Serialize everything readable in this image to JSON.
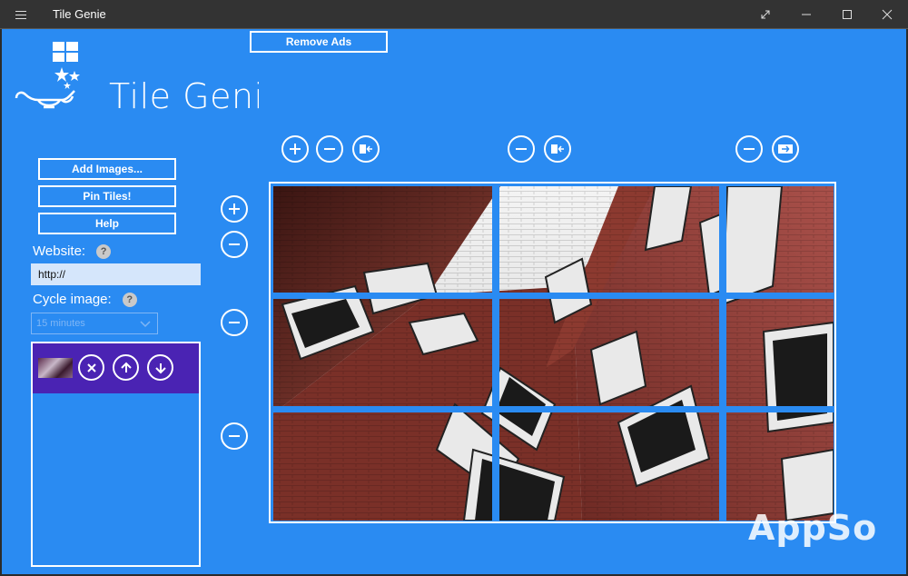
{
  "titlebar": {
    "title": "Tile Genie"
  },
  "header": {
    "remove_ads_label": "Remove Ads",
    "logo_text": "Tile Genie"
  },
  "sidebar": {
    "buttons": [
      {
        "label": "Add Images..."
      },
      {
        "label": "Pin Tiles!"
      },
      {
        "label": "Help"
      }
    ],
    "website": {
      "label": "Website:",
      "help": "?",
      "value": "http://"
    },
    "cycle": {
      "label": "Cycle image:",
      "help": "?",
      "selected": "15 minutes"
    }
  },
  "watermark": "AppSo",
  "icons": {
    "add": "plus-circle-icon",
    "remove": "minus-circle-icon",
    "move_left": "move-left-icon",
    "move_right": "move-right-icon",
    "delete": "close-circle-icon",
    "up": "arrow-up-circle-icon",
    "down": "arrow-down-circle-icon"
  },
  "colors": {
    "app_background": "#2a8bf2",
    "titlebar": "#333333",
    "selected_item": "#4a23b3",
    "input_background": "#d5e6fb"
  }
}
